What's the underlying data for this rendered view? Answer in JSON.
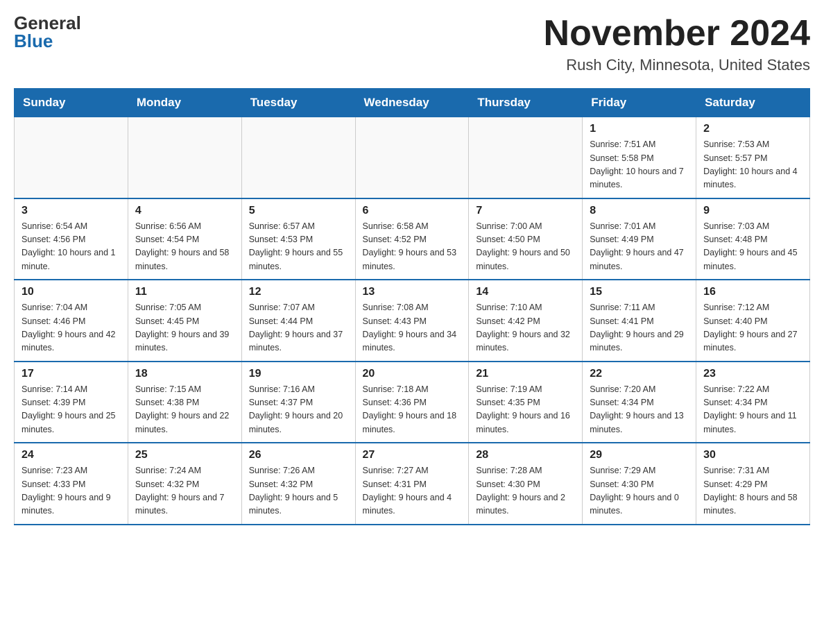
{
  "header": {
    "logo_general": "General",
    "logo_blue": "Blue",
    "month_title": "November 2024",
    "location": "Rush City, Minnesota, United States"
  },
  "weekdays": [
    "Sunday",
    "Monday",
    "Tuesday",
    "Wednesday",
    "Thursday",
    "Friday",
    "Saturday"
  ],
  "weeks": [
    [
      {
        "day": "",
        "info": ""
      },
      {
        "day": "",
        "info": ""
      },
      {
        "day": "",
        "info": ""
      },
      {
        "day": "",
        "info": ""
      },
      {
        "day": "",
        "info": ""
      },
      {
        "day": "1",
        "info": "Sunrise: 7:51 AM\nSunset: 5:58 PM\nDaylight: 10 hours and 7 minutes."
      },
      {
        "day": "2",
        "info": "Sunrise: 7:53 AM\nSunset: 5:57 PM\nDaylight: 10 hours and 4 minutes."
      }
    ],
    [
      {
        "day": "3",
        "info": "Sunrise: 6:54 AM\nSunset: 4:56 PM\nDaylight: 10 hours and 1 minute."
      },
      {
        "day": "4",
        "info": "Sunrise: 6:56 AM\nSunset: 4:54 PM\nDaylight: 9 hours and 58 minutes."
      },
      {
        "day": "5",
        "info": "Sunrise: 6:57 AM\nSunset: 4:53 PM\nDaylight: 9 hours and 55 minutes."
      },
      {
        "day": "6",
        "info": "Sunrise: 6:58 AM\nSunset: 4:52 PM\nDaylight: 9 hours and 53 minutes."
      },
      {
        "day": "7",
        "info": "Sunrise: 7:00 AM\nSunset: 4:50 PM\nDaylight: 9 hours and 50 minutes."
      },
      {
        "day": "8",
        "info": "Sunrise: 7:01 AM\nSunset: 4:49 PM\nDaylight: 9 hours and 47 minutes."
      },
      {
        "day": "9",
        "info": "Sunrise: 7:03 AM\nSunset: 4:48 PM\nDaylight: 9 hours and 45 minutes."
      }
    ],
    [
      {
        "day": "10",
        "info": "Sunrise: 7:04 AM\nSunset: 4:46 PM\nDaylight: 9 hours and 42 minutes."
      },
      {
        "day": "11",
        "info": "Sunrise: 7:05 AM\nSunset: 4:45 PM\nDaylight: 9 hours and 39 minutes."
      },
      {
        "day": "12",
        "info": "Sunrise: 7:07 AM\nSunset: 4:44 PM\nDaylight: 9 hours and 37 minutes."
      },
      {
        "day": "13",
        "info": "Sunrise: 7:08 AM\nSunset: 4:43 PM\nDaylight: 9 hours and 34 minutes."
      },
      {
        "day": "14",
        "info": "Sunrise: 7:10 AM\nSunset: 4:42 PM\nDaylight: 9 hours and 32 minutes."
      },
      {
        "day": "15",
        "info": "Sunrise: 7:11 AM\nSunset: 4:41 PM\nDaylight: 9 hours and 29 minutes."
      },
      {
        "day": "16",
        "info": "Sunrise: 7:12 AM\nSunset: 4:40 PM\nDaylight: 9 hours and 27 minutes."
      }
    ],
    [
      {
        "day": "17",
        "info": "Sunrise: 7:14 AM\nSunset: 4:39 PM\nDaylight: 9 hours and 25 minutes."
      },
      {
        "day": "18",
        "info": "Sunrise: 7:15 AM\nSunset: 4:38 PM\nDaylight: 9 hours and 22 minutes."
      },
      {
        "day": "19",
        "info": "Sunrise: 7:16 AM\nSunset: 4:37 PM\nDaylight: 9 hours and 20 minutes."
      },
      {
        "day": "20",
        "info": "Sunrise: 7:18 AM\nSunset: 4:36 PM\nDaylight: 9 hours and 18 minutes."
      },
      {
        "day": "21",
        "info": "Sunrise: 7:19 AM\nSunset: 4:35 PM\nDaylight: 9 hours and 16 minutes."
      },
      {
        "day": "22",
        "info": "Sunrise: 7:20 AM\nSunset: 4:34 PM\nDaylight: 9 hours and 13 minutes."
      },
      {
        "day": "23",
        "info": "Sunrise: 7:22 AM\nSunset: 4:34 PM\nDaylight: 9 hours and 11 minutes."
      }
    ],
    [
      {
        "day": "24",
        "info": "Sunrise: 7:23 AM\nSunset: 4:33 PM\nDaylight: 9 hours and 9 minutes."
      },
      {
        "day": "25",
        "info": "Sunrise: 7:24 AM\nSunset: 4:32 PM\nDaylight: 9 hours and 7 minutes."
      },
      {
        "day": "26",
        "info": "Sunrise: 7:26 AM\nSunset: 4:32 PM\nDaylight: 9 hours and 5 minutes."
      },
      {
        "day": "27",
        "info": "Sunrise: 7:27 AM\nSunset: 4:31 PM\nDaylight: 9 hours and 4 minutes."
      },
      {
        "day": "28",
        "info": "Sunrise: 7:28 AM\nSunset: 4:30 PM\nDaylight: 9 hours and 2 minutes."
      },
      {
        "day": "29",
        "info": "Sunrise: 7:29 AM\nSunset: 4:30 PM\nDaylight: 9 hours and 0 minutes."
      },
      {
        "day": "30",
        "info": "Sunrise: 7:31 AM\nSunset: 4:29 PM\nDaylight: 8 hours and 58 minutes."
      }
    ]
  ]
}
